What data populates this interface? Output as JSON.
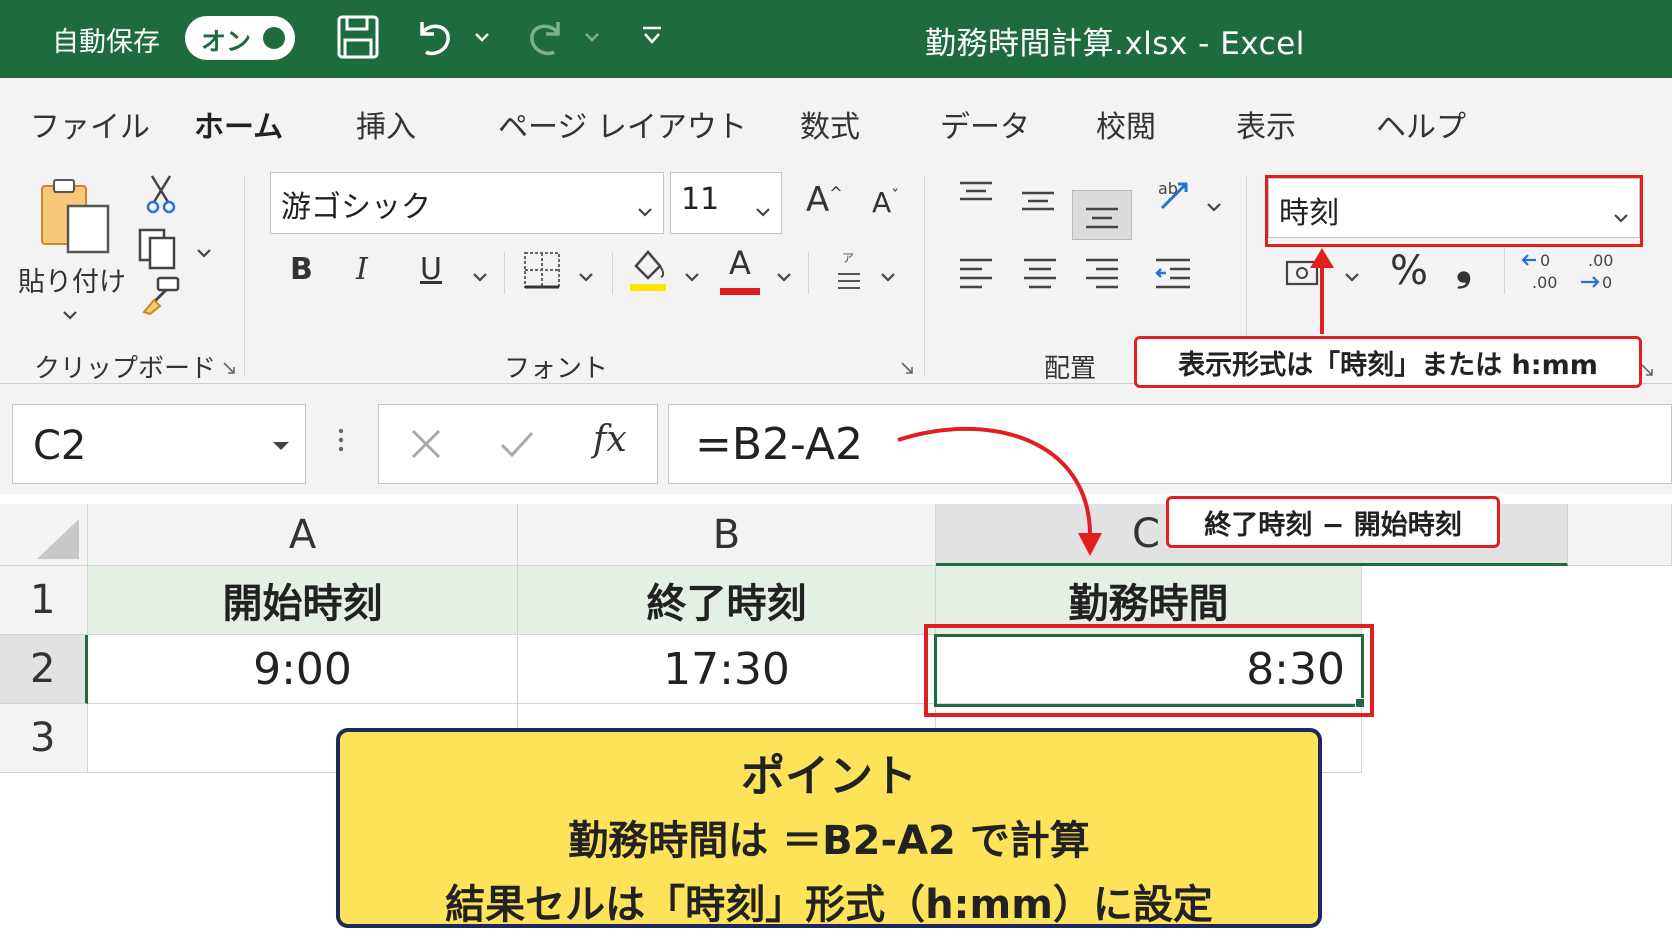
{
  "titlebar": {
    "autosave_label": "自動保存",
    "autosave_toggle": "オン",
    "document_title": "勤務時間計算.xlsx  -  Excel"
  },
  "tabs": [
    {
      "label": "ファイル",
      "active": false
    },
    {
      "label": "ホーム",
      "active": true
    },
    {
      "label": "挿入",
      "active": false
    },
    {
      "label": "ページ レイアウト",
      "active": false
    },
    {
      "label": "数式",
      "active": false
    },
    {
      "label": "データ",
      "active": false
    },
    {
      "label": "校閲",
      "active": false
    },
    {
      "label": "表示",
      "active": false
    },
    {
      "label": "ヘルプ",
      "active": false
    }
  ],
  "ribbon": {
    "clipboard": {
      "paste_label": "貼り付け",
      "group_label": "クリップボード"
    },
    "font": {
      "font_name": "游ゴシック",
      "font_size": "11",
      "bold": "B",
      "italic": "I",
      "underline": "U",
      "grow": "A",
      "shrink": "A",
      "font_color_letter": "A",
      "highlight_color": "#ffe600",
      "font_color": "#e01e1e",
      "group_label": "フォント"
    },
    "alignment": {
      "group_label": "配置"
    },
    "number": {
      "format": "時刻",
      "percent": "%",
      "comma": "❟"
    }
  },
  "formula_bar": {
    "name_box": "C2",
    "formula": "=B2-A2",
    "fx": "fx"
  },
  "sheet": {
    "columns": [
      "A",
      "B",
      "C"
    ],
    "selected_column": "C",
    "rows": [
      "1",
      "2",
      "3"
    ],
    "selected_row": "2",
    "headers": [
      "開始時刻",
      "終了時刻",
      "勤務時間"
    ],
    "values": [
      "9:00",
      "17:30",
      "8:30"
    ]
  },
  "annotations": {
    "format_callout": "表示形式は「時刻」または h:mm",
    "formula_callout": "終了時刻 − 開始時刻",
    "accent_color": "#e02020"
  },
  "point_box": {
    "title": "ポイント",
    "line1": "勤務時間は ＝B2-A2 で計算",
    "line2": "結果セルは「時刻」形式（h:mm）に設定",
    "background": "#fde35a"
  }
}
